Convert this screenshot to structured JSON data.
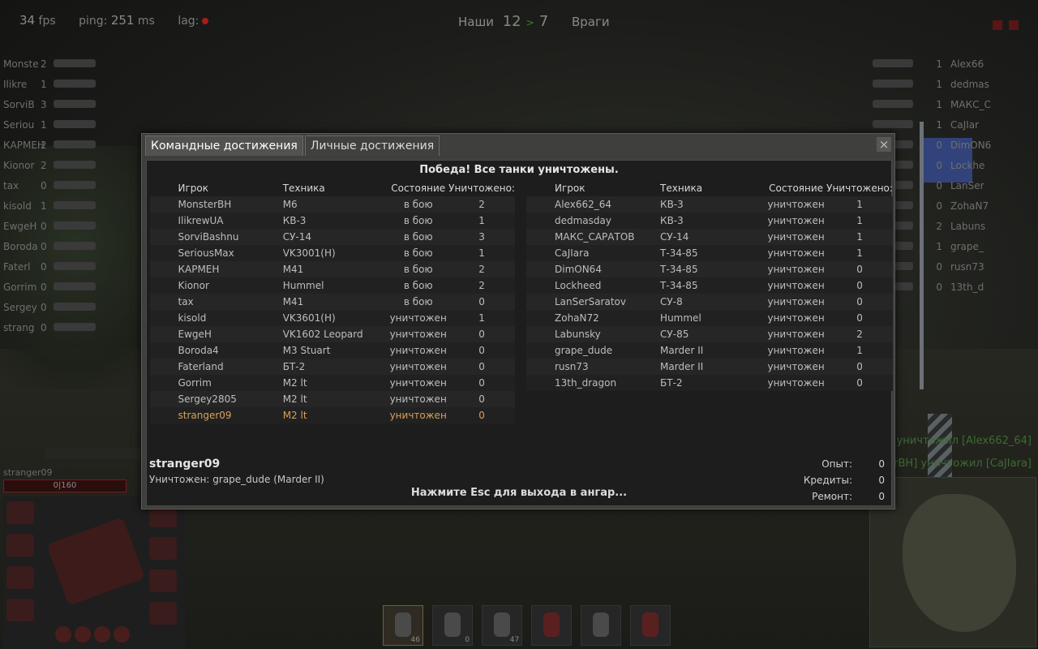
{
  "hud": {
    "fps": "34",
    "fps_unit": "fps",
    "ping_label": "ping:",
    "ping": "251",
    "ping_unit": "ms",
    "lag_label": "lag:",
    "score": {
      "ally_label": "Наши",
      "ally": "12",
      "separator": ">",
      "enemy": "7",
      "enemy_label": "Враги"
    }
  },
  "team_left": [
    {
      "name": "Monste",
      "kills": "2"
    },
    {
      "name": "Ilikre",
      "kills": "1"
    },
    {
      "name": "SorviB",
      "kills": "3"
    },
    {
      "name": "Seriou",
      "kills": "1"
    },
    {
      "name": "КАРМЕН",
      "kills": "2"
    },
    {
      "name": "Kionor",
      "kills": "2"
    },
    {
      "name": "tax",
      "kills": "0"
    },
    {
      "name": "kisold",
      "kills": "1"
    },
    {
      "name": "EwgeH",
      "kills": "0"
    },
    {
      "name": "Boroda",
      "kills": "0"
    },
    {
      "name": "Faterl",
      "kills": "0"
    },
    {
      "name": "Gorrim",
      "kills": "0"
    },
    {
      "name": "Sergey",
      "kills": "0"
    },
    {
      "name": "strang",
      "kills": "0"
    }
  ],
  "team_right": [
    {
      "name": "Alex66",
      "kills": "1"
    },
    {
      "name": "dedmas",
      "kills": "1"
    },
    {
      "name": "МАКС_С",
      "kills": "1"
    },
    {
      "name": "CaJIar",
      "kills": "1"
    },
    {
      "name": "DimON6",
      "kills": "0"
    },
    {
      "name": "Lockhe",
      "kills": "0"
    },
    {
      "name": "LanSer",
      "kills": "0"
    },
    {
      "name": "ZohaN7",
      "kills": "0"
    },
    {
      "name": "Labuns",
      "kills": "2"
    },
    {
      "name": "grape_",
      "kills": "1"
    },
    {
      "name": "rusn73",
      "kills": "0"
    },
    {
      "name": "13th_d",
      "kills": "0"
    }
  ],
  "player_hud": {
    "name": "stranger09",
    "hp": "0|160"
  },
  "consumables": [
    "46",
    "0",
    "47"
  ],
  "killfeed": [
    "EH] уничтожил [Alex662_64]",
    "nsterBH] уничтожил [CaJIara]"
  ],
  "dialog": {
    "tabs": [
      "Командные достижения",
      "Личные достижения"
    ],
    "close": "×",
    "result": "Победа! Все танки уничтожены.",
    "headers": [
      "Игрок",
      "Техника",
      "Состояние",
      "Уничтожено:"
    ],
    "ally_rows": [
      [
        "MonsterBH",
        "M6",
        "в бою",
        "2"
      ],
      [
        "IlikrewUA",
        "КВ-3",
        "в бою",
        "1"
      ],
      [
        "SorviBashnu",
        "СУ-14",
        "в бою",
        "3"
      ],
      [
        "SeriousMax",
        "VK3001(H)",
        "в бою",
        "1"
      ],
      [
        "КАРМЕН",
        "M41",
        "в бою",
        "2"
      ],
      [
        "Kionor",
        "Hummel",
        "в бою",
        "2"
      ],
      [
        "tax",
        "M41",
        "в бою",
        "0"
      ],
      [
        "kisold",
        "VK3601(H)",
        "уничтожен",
        "1"
      ],
      [
        "EwgeH",
        "VK1602 Leopard",
        "уничтожен",
        "0"
      ],
      [
        "Boroda4",
        "M3 Stuart",
        "уничтожен",
        "0"
      ],
      [
        "Faterland",
        "БТ-2",
        "уничтожен",
        "0"
      ],
      [
        "Gorrim",
        "M2 lt",
        "уничтожен",
        "0"
      ],
      [
        "Sergey2805",
        "M2 lt",
        "уничтожен",
        "0"
      ],
      [
        "stranger09",
        "M2 lt",
        "уничтожен",
        "0"
      ]
    ],
    "enemy_rows": [
      [
        "Alex662_64",
        "КВ-3",
        "уничтожен",
        "1"
      ],
      [
        "dedmasday",
        "КВ-3",
        "уничтожен",
        "1"
      ],
      [
        "МАКС_САРАТОВ",
        "СУ-14",
        "уничтожен",
        "1"
      ],
      [
        "CaJIara",
        "Т-34-85",
        "уничтожен",
        "1"
      ],
      [
        "DimON64",
        "Т-34-85",
        "уничтожен",
        "0"
      ],
      [
        "Lockheed",
        "Т-34-85",
        "уничтожен",
        "0"
      ],
      [
        "LanSerSaratov",
        "СУ-8",
        "уничтожен",
        "0"
      ],
      [
        "ZohaN72",
        "Hummel",
        "уничтожен",
        "0"
      ],
      [
        "Labunsky",
        "СУ-85",
        "уничтожен",
        "2"
      ],
      [
        "grape_dude",
        "Marder II",
        "уничтожен",
        "1"
      ],
      [
        "rusn73",
        "Marder II",
        "уничтожен",
        "0"
      ],
      [
        "13th_dragon",
        "БТ-2",
        "уничтожен",
        "0"
      ]
    ],
    "highlight_player": "stranger09",
    "footer": {
      "player_name": "stranger09",
      "killed_by": "Уничтожен: grape_dude (Marder II)",
      "esc_hint": "Нажмите Esc для выхода в ангар...",
      "stats": [
        {
          "label": "Опыт:",
          "value": "0"
        },
        {
          "label": "Кредиты:",
          "value": "0"
        },
        {
          "label": "Ремонт:",
          "value": "0"
        }
      ]
    }
  }
}
